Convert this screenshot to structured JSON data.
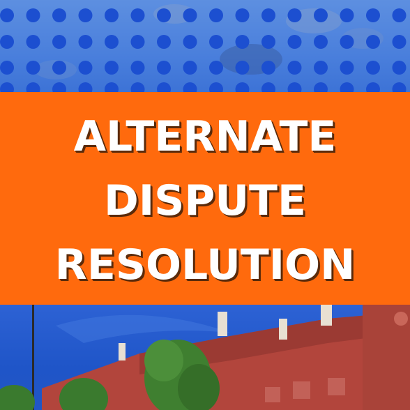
{
  "title": {
    "line1": "ALTERNATE",
    "line2": "DISPUTE",
    "line3": "RESOLUTION"
  },
  "colors": {
    "orange": "#ff6a0d",
    "blue": "#1f5ed6",
    "dot": "#1c4fd0",
    "building": "#b84a40",
    "tree": "#3f7f30"
  }
}
